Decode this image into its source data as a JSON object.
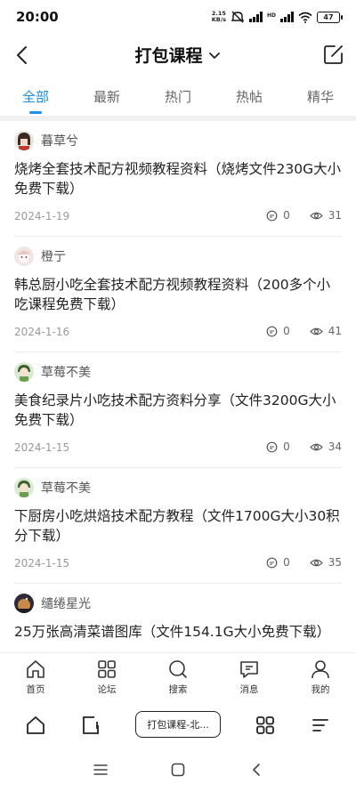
{
  "status_bar": {
    "time": "20:00",
    "net_speed_value": "2.15",
    "net_speed_unit": "KB/s",
    "network_type": "HD",
    "battery": "47"
  },
  "header": {
    "title": "打包课程"
  },
  "tabs": [
    {
      "label": "全部",
      "active": true
    },
    {
      "label": "最新",
      "active": false
    },
    {
      "label": "热门",
      "active": false
    },
    {
      "label": "热帖",
      "active": false
    },
    {
      "label": "精华",
      "active": false
    }
  ],
  "posts": [
    {
      "author": "暮草兮",
      "title": "烧烤全套技术配方视频教程资料（烧烤文件230G大小免费下载）",
      "date": "2024-1-19",
      "comments": "0",
      "views": "31"
    },
    {
      "author": "橙亍",
      "title": "韩总厨小吃全套技术配方视频教程资料（200多个小吃课程免费下载）",
      "date": "2024-1-16",
      "comments": "0",
      "views": "41"
    },
    {
      "author": "草莓不美",
      "title": "美食纪录片小吃技术配方资料分享（文件3200G大小免费下载）",
      "date": "2024-1-15",
      "comments": "0",
      "views": "34"
    },
    {
      "author": "草莓不美",
      "title": "下厨房小吃烘焙技术配方教程（文件1700G大小30积分下载）",
      "date": "2024-1-15",
      "comments": "0",
      "views": "35"
    },
    {
      "author": "缱绻星光",
      "title": "25万张高清菜谱图库（文件154.1G大小免费下载）",
      "date": "",
      "comments": "",
      "views": ""
    }
  ],
  "bottom_nav": [
    {
      "label": "首页",
      "icon": "home-icon"
    },
    {
      "label": "论坛",
      "icon": "grid-icon"
    },
    {
      "label": "搜索",
      "icon": "search-icon"
    },
    {
      "label": "消息",
      "icon": "message-icon"
    },
    {
      "label": "我的",
      "icon": "person-icon"
    }
  ],
  "browser_bar": {
    "tab_label": "打包课程-北..."
  },
  "colors": {
    "accent": "#1a8ee8",
    "text": "#222222",
    "muted": "#999999"
  }
}
